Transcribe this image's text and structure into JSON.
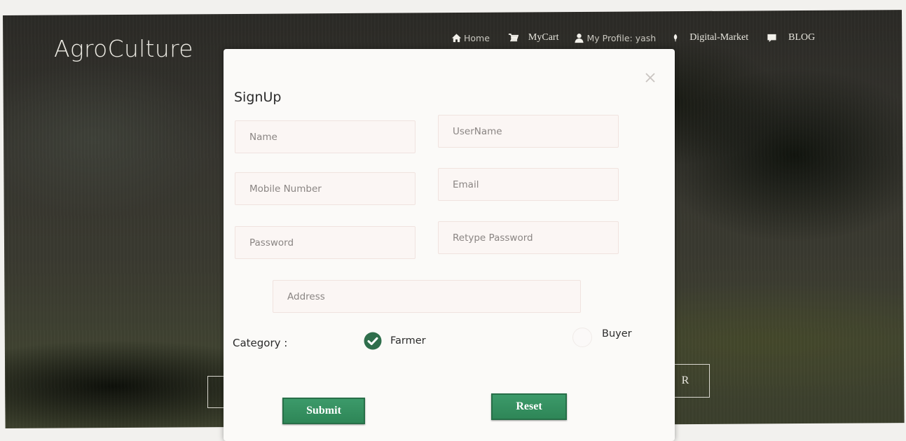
{
  "brand": "AgroCulture",
  "nav": [
    {
      "icon": "home-icon",
      "label": "Home"
    },
    {
      "icon": "cart-icon",
      "label": "MyCart"
    },
    {
      "icon": "user-icon",
      "label": "My Profile: yash"
    },
    {
      "icon": "leaf-icon",
      "label": "Digital-Market"
    },
    {
      "icon": "comment-icon",
      "label": "BLOG"
    }
  ],
  "hero_button_right": "R",
  "modal": {
    "title": "SignUp",
    "fields": {
      "name": "Name",
      "username": "UserName",
      "mobile": "Mobile Number",
      "email": "Email",
      "password": "Password",
      "retype_password": "Retype Password",
      "address": "Address"
    },
    "category_label": "Category :",
    "options": [
      {
        "label": "Farmer",
        "selected": true
      },
      {
        "label": "Buyer",
        "selected": false
      }
    ],
    "submit_label": "Submit",
    "reset_label": "Reset"
  },
  "colors": {
    "accent_green": "#2e8657",
    "check_green": "#2f6e4c",
    "modal_bg": "#fbfaf8",
    "field_border": "#f0e3df"
  }
}
